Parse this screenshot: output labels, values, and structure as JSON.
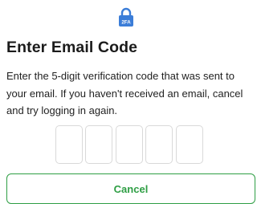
{
  "header": {
    "badge_icon": "lock-2fa-icon",
    "badge_text": "2FA",
    "badge_color": "#3b7dd8"
  },
  "title": "Enter Email Code",
  "description": "Enter the 5-digit verification code that was sent to your email. If you haven't received an email, cancel and try logging in again.",
  "code_inputs": [
    "",
    "",
    "",
    "",
    ""
  ],
  "cancel_label": "Cancel",
  "colors": {
    "accent": "#2e9e44",
    "input_border": "#d9d9d9"
  }
}
